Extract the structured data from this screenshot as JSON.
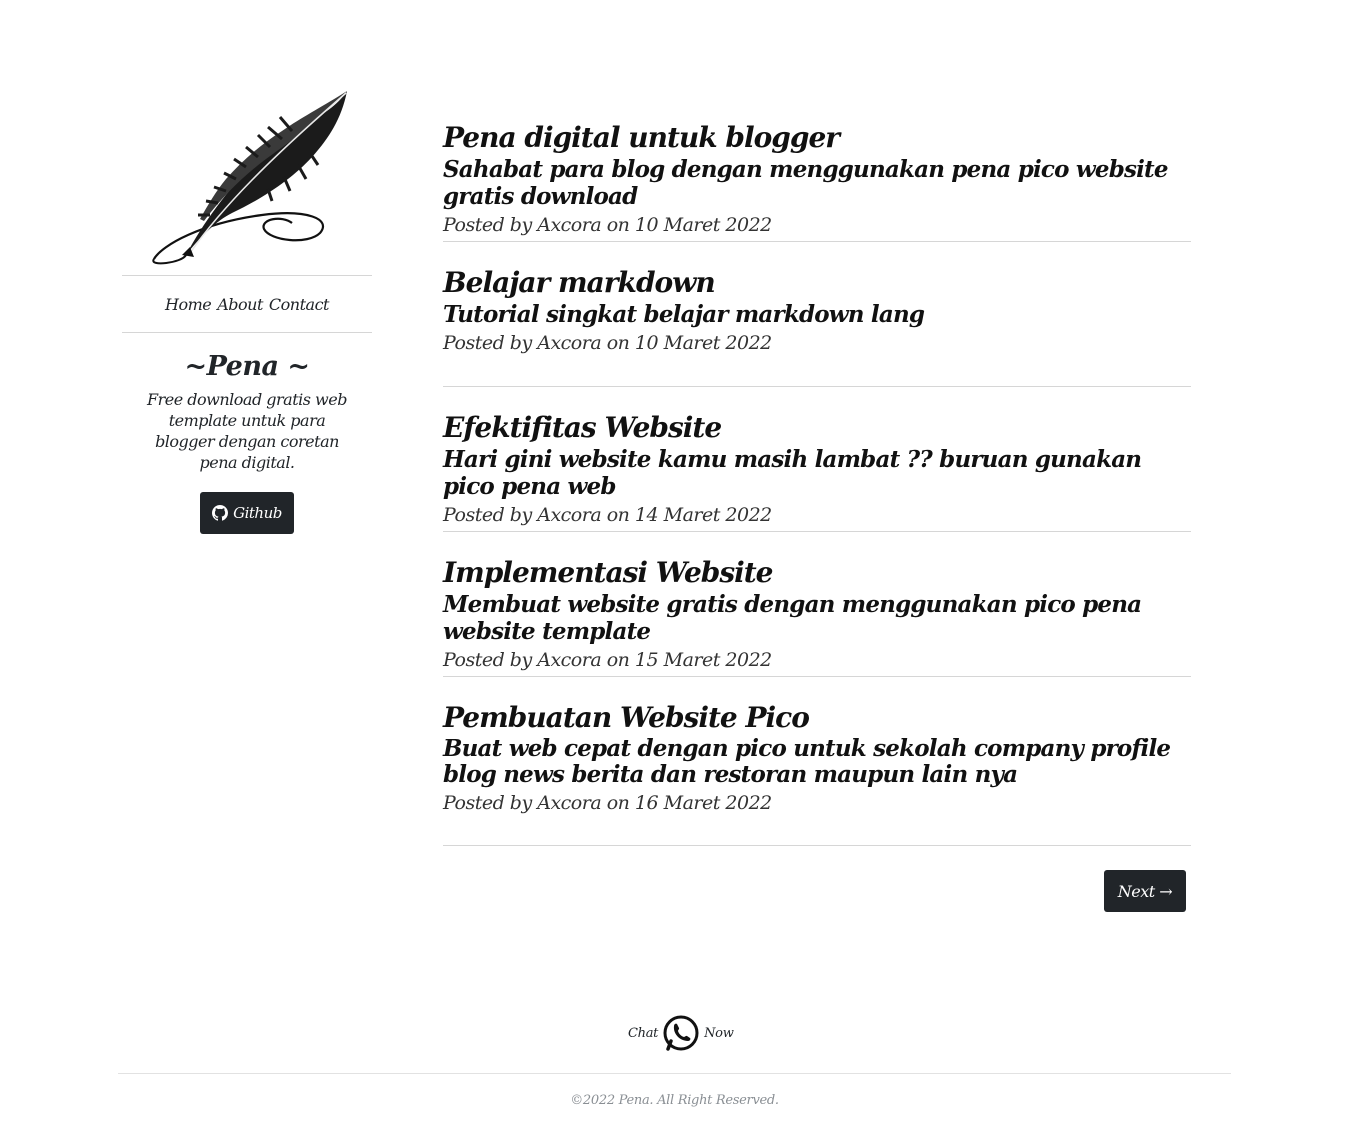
{
  "nav": {
    "home": "Home",
    "about": "About",
    "contact": "Contact"
  },
  "brand": {
    "title": "~Pena ~",
    "description": "Free download gratis web template untuk para blogger dengan coretan pena digital.",
    "github_label": "Github"
  },
  "posts": [
    {
      "title": "Pena digital untuk blogger",
      "subtitle": "Sahabat para blog dengan menggunakan pena pico website gratis download",
      "meta": "Posted by Axcora on 10 Maret 2022"
    },
    {
      "title": "Belajar markdown",
      "subtitle": "Tutorial singkat belajar markdown lang",
      "meta": "Posted by Axcora on 10 Maret 2022"
    },
    {
      "title": "Efektifitas Website",
      "subtitle": "Hari gini website kamu masih lambat ?? buruan gunakan pico pena web",
      "meta": "Posted by Axcora on 14 Maret 2022"
    },
    {
      "title": "Implementasi Website",
      "subtitle": "Membuat website gratis dengan menggunakan pico pena website template",
      "meta": "Posted by Axcora on 15 Maret 2022"
    },
    {
      "title": "Pembuatan Website Pico",
      "subtitle": "Buat web cepat dengan pico untuk sekolah company profile blog news berita dan restoran maupun lain nya",
      "meta": "Posted by Axcora on 16 Maret 2022"
    }
  ],
  "pagination": {
    "next_label": "Next →"
  },
  "chat": {
    "left": "Chat",
    "right": "Now"
  },
  "footer": {
    "copyright": "©2022 Pena. All Right Reserved."
  },
  "colors": {
    "dark": "#212529",
    "divider": "#d6d6d6",
    "footer_text": "#8a8f94"
  }
}
